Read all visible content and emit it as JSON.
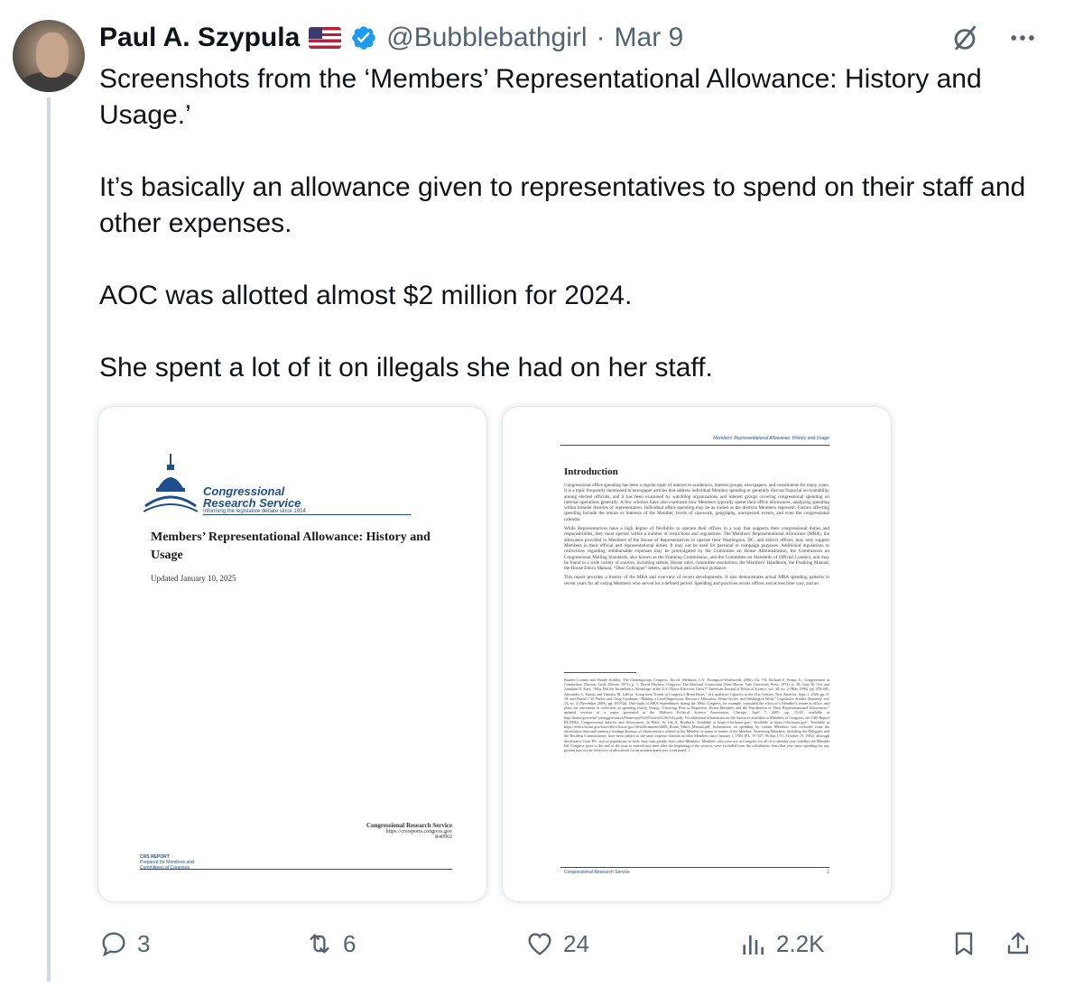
{
  "tweet": {
    "author_name": "Paul A. Szypula",
    "handle": "@Bubblebathgirl",
    "separator": "·",
    "date": "Mar 9",
    "paragraphs": [
      "Screenshots from the ‘Members’ Representational Allowance: History and Usage.’",
      "It’s basically an allowance given to representatives to spend on their staff and other expenses.",
      "AOC was allotted almost $2 million for 2024.",
      "She spent a lot of it on illegals she had on her staff."
    ]
  },
  "icons": {
    "flag": "us-flag-icon",
    "verified": "verified-badge-icon",
    "grok": "grok-icon",
    "more": "more-icon",
    "reply": "reply-icon",
    "retweet": "retweet-icon",
    "like": "heart-icon",
    "views": "views-icon",
    "bookmark": "bookmark-icon",
    "share": "share-icon"
  },
  "media": {
    "doc1": {
      "logo_line1": "Congressional",
      "logo_line2": "Research Service",
      "logo_tagline": "Informing the legislative debate since 1914",
      "title": "Members’ Representational Allowance: History and Usage",
      "updated": "Updated January 10, 2025",
      "footer_org": "Congressional Research Service",
      "footer_url": "https://crsreports.congress.gov",
      "footer_id": "R40962",
      "report_label": "CRS REPORT",
      "report_sub1": "Prepared for Members and",
      "report_sub2": "Committees of Congress"
    },
    "doc2": {
      "running_header": "Members’ Representational Allowance: History and Usage",
      "heading": "Introduction",
      "para1": "Congressional office spending has been a regular topic of interest to academics, interest groups, newspapers, and constituents for many years. It is a topic frequently mentioned in newspaper articles that address individual Member spending or generally discuss financial accountability among elected officials, and it has been examined by watchdog organizations and interest groups covering congressional spending on internal operations generally. A few scholars have also examined how Members typically spend their office allowances, analyzing spending within broader theories of representation. Individual office spending may be as varied as the districts Members represent. Factors affecting spending include the tenure or interests of the Member, levels of casework, geography, unexpected events, and even the congressional calendar.",
      "para2": "While Representatives have a high degree of flexibility to operate their offices in a way that supports their congressional duties and responsibilities, they must operate within a number of restrictions and regulations. The Members’ Representational Allowance (MRA), the allowance provided to Members of the House of Representatives to operate their Washington, DC, and district offices, may only support Members in their official and representational duties. It may not be used for personal or campaign purposes. Additional regulations or restrictions regarding reimbursable expenses may be promulgated by the Committee on House Administration, the Commission on Congressional Mailing Standards, also known as the Franking Commission, and the Committee on Standards of Official Conduct, and may be found in a wide variety of sources, including statute, House rules, committee resolutions, the Members’ Handbook, the Franking Manual, the House Ethics Manual, “Dear Colleague” letters, and formal and informal guidance.",
      "para3": "This report provides a history of the MRA and overview of recent developments. It also demonstrates actual MRA spending patterns in recent years for all voting Members who served for a defined period. Spending and practices across offices and across time vary, and an",
      "notes": "Burdett Loomis and Wendy Schiller, The Contemporary Congress, 5th ed. (Belmont, CA: Thompson-Wadsworth, 2006), Ch. 7-8; Richard F. Fenno, Jr., Congressmen in Committees (Boston: Little, Brown, 1973), p. 1; David Mayhew, Congress: The Electoral Connection (New Haven: Yale University Press, 1974), p. 49; Gary W. Cox and Jonathan N. Katz, “Why Did the Incumbency Advantage in the U.S. House Elections Grow?” American Journal of Political Science, vol. 40, no. 2 (May 1996), pp. 478-481; Alexander C. Furnas and Timothy M. LaPira, “Long-term Trends in Congress’s Brain Drain,” in Legislative Capacity in the 21st Century, New America, Sept. 1, 2020, pp. 8-18; and David C.W. Parker and Craig Goodman, “Making a Good Impression: Resource Allocation, Home Styles, and Washington Work,” Legislative Studies Quarterly, vol. 34, no. 4 (November 2009), pp. 493-524. One study of MRA expenditures during the 106th Congress, for example, examined the effect of a Member’s tenure in office, and plans for retirement or reelection on spending (Garry Young, “Choosing How to Represent: House Members and the Distribution of Their Representational Allowances,” updated version of a paper presented at the Midwest Political Science Association, Chicago, April 7, 2005, pp. 15-18, available at http://home.gwu.edu/~youngg/research/Homestyle%20Choices%20v3.02.pdf). For additional information on the resources available to Members of Congress, see CRS Report RL30064, Congressional Salaries and Allowances: In Brief, by Ida A. Brudnick. Available at https://cha.house.gov/. Available at https://cha.house.gov/. Available at https://ethics.house.gov/sites/ethics.house.gov/files/documents/2008_House_Ethics_Manual.pdf. Information on spending by certain Members was excluded from the observation data and summary findings because of characteristics related to the Member or status or tenure of the Member. Nonvoting Members, including the Delegates and the Resident Commissioner, have been subject to the same expense formula as other Members since January 1, 1983 (P.L. 97-357, 96 Stat 1711, October 19, 1982), although the distance from DC, size of population, or both, may vary greatly from other Members. Members who were not in Congress for all of a calendar year, whether the Member left Congress prior to the end of the year or entered any time after the beginning of the session, were excluded from the calculations from that year since spending for any portion may not be reflective of allocations for an uninterrupted year. (continued...)",
      "footer": "Congressional Research Service",
      "page_number": "1"
    }
  },
  "actions": {
    "replies": "3",
    "retweets": "6",
    "likes": "24",
    "views": "2.2K"
  }
}
